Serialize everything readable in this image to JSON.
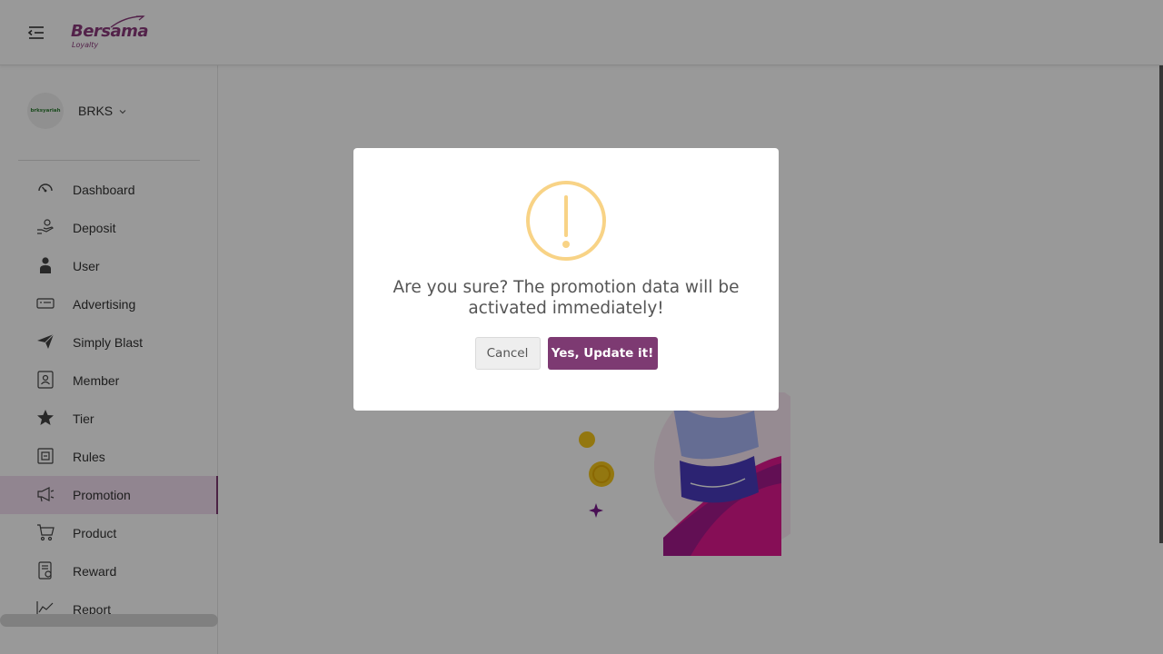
{
  "header": {
    "logo_main": "Bersama",
    "logo_sub": "Loyalty",
    "menu_icon": "collapse-menu-icon"
  },
  "sidebar": {
    "brand": {
      "name": "BRKS",
      "avatar_text": "brksyariah"
    },
    "items": [
      {
        "label": "Dashboard",
        "icon": "speedometer-icon",
        "active": false
      },
      {
        "label": "Deposit",
        "icon": "hand-coin-icon",
        "active": false
      },
      {
        "label": "User",
        "icon": "user-icon",
        "active": false
      },
      {
        "label": "Advertising",
        "icon": "ad-card-icon",
        "active": false
      },
      {
        "label": "Simply Blast",
        "icon": "paper-plane-icon",
        "active": false
      },
      {
        "label": "Member",
        "icon": "member-card-icon",
        "active": false
      },
      {
        "label": "Tier",
        "icon": "star-icon",
        "active": false
      },
      {
        "label": "Rules",
        "icon": "rules-icon",
        "active": false
      },
      {
        "label": "Promotion",
        "icon": "megaphone-icon",
        "active": true
      },
      {
        "label": "Product",
        "icon": "cart-icon",
        "active": false
      },
      {
        "label": "Reward",
        "icon": "reward-icon",
        "active": false
      },
      {
        "label": "Report",
        "icon": "chart-line-icon",
        "active": false
      }
    ]
  },
  "modal": {
    "title": "Are you sure? The promotion data will be activated immediately!",
    "cancel_label": "Cancel",
    "confirm_label": "Yes, Update it!",
    "icon": "warning-icon"
  },
  "colors": {
    "brand": "#7d3a72",
    "warning": "#f8d386",
    "active_bg": "#f2def0"
  }
}
